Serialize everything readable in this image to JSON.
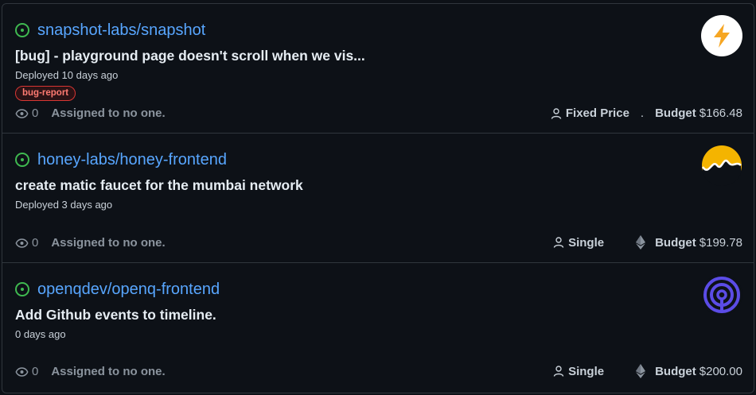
{
  "issues": [
    {
      "repo": "snapshot-labs/snapshot",
      "title": "[bug] - playground page doesn't scroll when we vis...",
      "deployed": "Deployed 10 days ago",
      "label": "bug-report",
      "watchers": "0",
      "assigned": "Assigned to no one.",
      "type": "Fixed Price",
      "budget_label": "Budget",
      "budget": "$166.48",
      "avatar_icon": "lightning-icon"
    },
    {
      "repo": "honey-labs/honey-frontend",
      "title": "create matic faucet for the mumbai network",
      "deployed": "Deployed 3 days ago",
      "watchers": "0",
      "assigned": "Assigned to no one.",
      "type": "Single",
      "budget_label": "Budget",
      "budget": "$199.78",
      "avatar_icon": "honey-logo-icon"
    },
    {
      "repo": "openqdev/openq-frontend",
      "title": "Add Github events to timeline.",
      "deployed": "0 days ago",
      "watchers": "0",
      "assigned": "Assigned to no one.",
      "type": "Single",
      "budget_label": "Budget",
      "budget": "$200.00",
      "avatar_icon": "openq-logo-icon"
    }
  ],
  "colors": {
    "background": "#0d1117",
    "link": "#58a6ff",
    "open_status": "#3fb950",
    "label_red": "#ff7b72",
    "border": "#30363d"
  }
}
